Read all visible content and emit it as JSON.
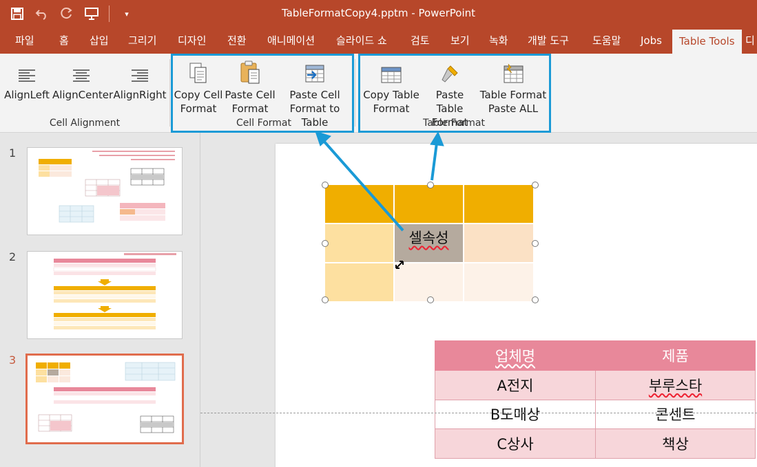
{
  "window": {
    "title": "TableFormatCopy4.pptm  -  PowerPoint"
  },
  "qat": {
    "save": "save-icon",
    "undo": "undo-icon",
    "redo": "redo-icon",
    "present": "present-icon",
    "customize": "▾"
  },
  "tabs": [
    "파일",
    "홈",
    "삽입",
    "그리기",
    "디자인",
    "전환",
    "애니메이션",
    "슬라이드 쇼",
    "검토",
    "보기",
    "녹화",
    "개발 도구",
    "도움말",
    "Jobs",
    "Table Tools",
    "디"
  ],
  "ribbon": {
    "cell_alignment": {
      "label": "Cell Alignment",
      "buttons": [
        "AlignLeft",
        "AlignCenter",
        "AlignRight"
      ]
    },
    "cell_format": {
      "label": "Cell Format",
      "buttons": [
        {
          "l1": "Copy Cell",
          "l2": "Format"
        },
        {
          "l1": "Paste Cell",
          "l2": "Format"
        },
        {
          "l1": "Paste Cell",
          "l2": "Format to Table"
        }
      ]
    },
    "table_format": {
      "label": "Table Format",
      "buttons": [
        {
          "l1": "Copy Table",
          "l2": "Format"
        },
        {
          "l1": "Paste Table",
          "l2": "Format"
        },
        {
          "l1": "Table Format",
          "l2": "Paste ALL"
        }
      ]
    }
  },
  "slides": {
    "numbers": [
      "1",
      "2",
      "3"
    ],
    "selected": 3
  },
  "slide": {
    "cell_text": "셀속성",
    "corp_table": {
      "headers": [
        "업체명",
        "제품"
      ],
      "rows": [
        [
          "A전지",
          "부루스타"
        ],
        [
          "B도매상",
          "콘센트"
        ],
        [
          "C상사",
          "책상"
        ]
      ]
    }
  },
  "colors": {
    "accent": "#b7472a",
    "highlight": "#1a9ad6",
    "gold": "#f0ae00",
    "pink_header": "#e8889a"
  }
}
